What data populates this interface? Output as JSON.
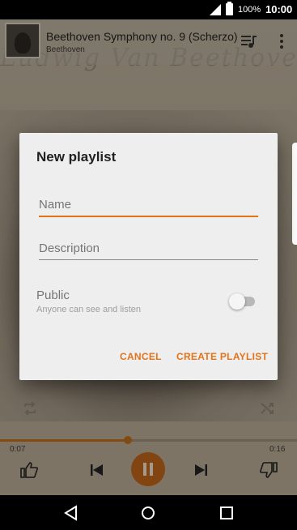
{
  "status_bar": {
    "battery_text": "100%",
    "time": "10:00"
  },
  "player": {
    "track_title": "Beethoven Symphony no. 9 (Scherzo)",
    "track_artist": "Beethoven",
    "art_script_text": "Ludwig Van Beethoven",
    "elapsed": "0:07",
    "total": "0:16",
    "progress_fraction": 0.43,
    "accent_color": "#c0651a"
  },
  "dialog": {
    "title": "New playlist",
    "name_placeholder": "Name",
    "name_value": "",
    "description_placeholder": "Description",
    "description_value": "",
    "public_label": "Public",
    "public_sublabel": "Anyone can see and listen",
    "public_enabled": false,
    "cancel_label": "CANCEL",
    "create_label": "CREATE PLAYLIST",
    "accent_color": "#e2741a"
  },
  "icons": {
    "status": [
      "signal-icon",
      "battery-icon"
    ],
    "header": [
      "album-art",
      "queue-music-icon",
      "more-vert-icon"
    ],
    "controls": [
      "repeat-icon",
      "shuffle-icon",
      "thumbs-up-icon",
      "skip-previous-icon",
      "pause-icon",
      "skip-next-icon",
      "thumbs-down-icon"
    ],
    "nav": [
      "back-icon",
      "home-icon",
      "recents-icon"
    ]
  }
}
